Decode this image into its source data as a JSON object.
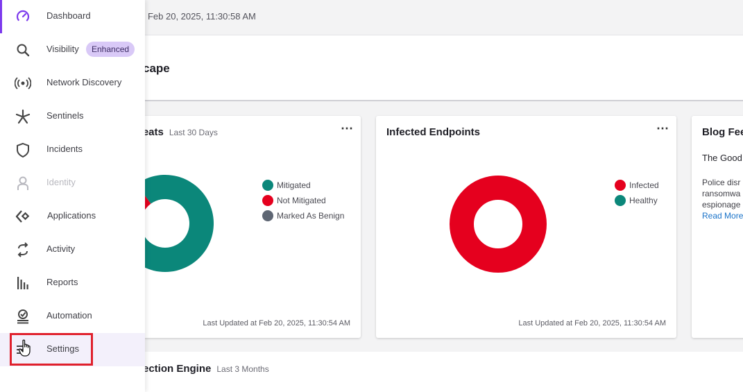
{
  "topbar": {
    "timestamp": "| Feb 20, 2025, 11:30:58 AM"
  },
  "page": {
    "title": "cape"
  },
  "cards": {
    "threats": {
      "title": "reats",
      "subtitle": "Last 30 Days",
      "more": "⋯",
      "legend": [
        "Mitigated",
        "Not Mitigated",
        "Marked As Benign"
      ],
      "updated": "Last Updated at Feb 20, 2025, 11:30:54 AM"
    },
    "infected": {
      "title": "Infected Endpoints",
      "more": "⋯",
      "legend": [
        "Infected",
        "Healthy"
      ],
      "updated": "Last Updated at Feb 20, 2025, 11:30:54 AM"
    },
    "blog": {
      "title": "Blog Fee",
      "headline": "The Good",
      "lines": [
        "Police disr",
        "ransomwa",
        "espionage"
      ],
      "read_more": "Read More"
    }
  },
  "bottom": {
    "title": "ection Engine",
    "subtitle": "Last 3 Months"
  },
  "sidebar": {
    "items": [
      {
        "label": "Dashboard",
        "icon": "dashboard-gauge-icon"
      },
      {
        "label": "Visibility",
        "icon": "search-icon",
        "badge": "Enhanced"
      },
      {
        "label": "Network Discovery",
        "icon": "broadcast-icon"
      },
      {
        "label": "Sentinels",
        "icon": "sentinel-star-icon"
      },
      {
        "label": "Incidents",
        "icon": "shield-icon"
      },
      {
        "label": "Identity",
        "icon": "person-icon"
      },
      {
        "label": "Applications",
        "icon": "applications-icon"
      },
      {
        "label": "Activity",
        "icon": "sync-arrows-icon"
      },
      {
        "label": "Reports",
        "icon": "bar-chart-icon"
      },
      {
        "label": "Automation",
        "icon": "automation-icon"
      },
      {
        "label": "Settings",
        "icon": "settings-sliders-icon"
      }
    ]
  },
  "colors": {
    "mitigated": "#0b877a",
    "not_mitigated": "#e5001e",
    "benign": "#5e6673",
    "infected": "#e5001e",
    "healthy": "#0b877a",
    "accent": "#7c3aed"
  },
  "chart_data": [
    {
      "type": "pie",
      "categories": [
        "Mitigated",
        "Not Mitigated",
        "Marked As Benign"
      ],
      "values": [
        90,
        10,
        0
      ]
    },
    {
      "type": "pie",
      "categories": [
        "Infected",
        "Healthy"
      ],
      "values": [
        100,
        0
      ]
    }
  ]
}
